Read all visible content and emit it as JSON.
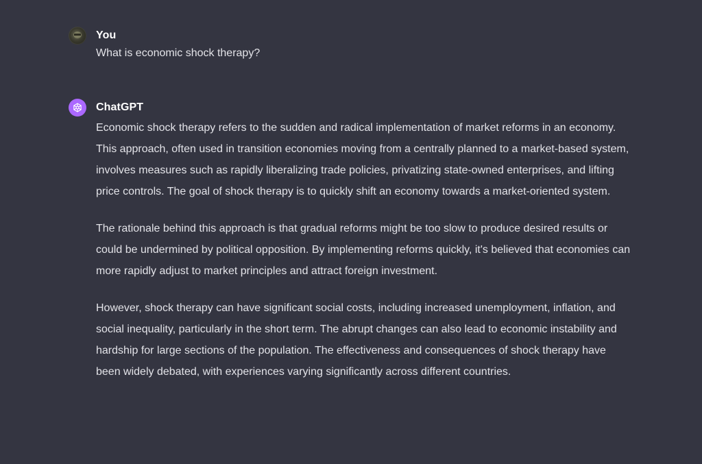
{
  "conversation": {
    "user": {
      "name": "You",
      "avatar_icon": "user-avatar-icon",
      "message": "What is economic shock therapy?"
    },
    "assistant": {
      "name": "ChatGPT",
      "avatar_icon": "openai-logo-icon",
      "avatar_color": "#ab68ff",
      "paragraphs": [
        "Economic shock therapy refers to the sudden and radical implementation of market reforms in an economy. This approach, often used in transition economies moving from a centrally planned to a market-based system, involves measures such as rapidly liberalizing trade policies, privatizing state-owned enterprises, and lifting price controls. The goal of shock therapy is to quickly shift an economy towards a market-oriented system.",
        "The rationale behind this approach is that gradual reforms might be too slow to produce desired results or could be undermined by political opposition. By implementing reforms quickly, it's believed that economies can more rapidly adjust to market principles and attract foreign investment.",
        "However, shock therapy can have significant social costs, including increased unemployment, inflation, and social inequality, particularly in the short term. The abrupt changes can also lead to economic instability and hardship for large sections of the population. The effectiveness and consequences of shock therapy have been widely debated, with experiences varying significantly across different countries."
      ]
    }
  },
  "colors": {
    "background": "#343541",
    "text": "#ececf1",
    "assistant_accent": "#ab68ff"
  }
}
